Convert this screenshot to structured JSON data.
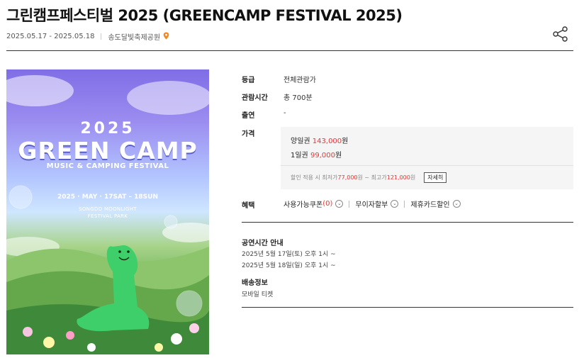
{
  "header": {
    "title": "그린캠프페스티벌 2025 (GREENCAMP FESTIVAL 2025)",
    "period": "2025.05.17 - 2025.05.18",
    "venue": "송도달빛축제공원",
    "share_icon": "share-icon",
    "pin_icon": "location-pin-icon",
    "pin_color": "#f08a24"
  },
  "poster": {
    "year": "2025",
    "main": "GREEN CAMP",
    "sub": "MUSIC & CAMPING FESTIVAL",
    "dates": "2025 · MAY · 17SAT – 18SUN",
    "venue_line1": "SONGDO MOONLIGHT",
    "venue_line2": "FESTIVAL PARK"
  },
  "info": {
    "grade_label": "등급",
    "grade_value": "전체관람가",
    "runtime_label": "관람시간",
    "runtime_value": "총 700분",
    "cast_label": "출연",
    "cast_value": "-",
    "price_label": "가격",
    "prices": [
      {
        "name": "양일권",
        "amount": "143,000",
        "unit": "원"
      },
      {
        "name": "1일권",
        "amount": "99,000",
        "unit": "원"
      }
    ],
    "discount_prefix": "할인 적용 시 최저가 ",
    "discount_min": "77,000",
    "discount_mid": "원 ~ 최고가 ",
    "discount_max": "121,000",
    "discount_suffix": "원",
    "detail_button": "자세히",
    "benefit_label": "혜택",
    "benefit_coupon": "사용가능쿠폰",
    "benefit_coupon_count": "(0)",
    "benefit_installment": "무이자할부",
    "benefit_card": "제휴카드할인"
  },
  "schedule": {
    "title": "공연시간 안내",
    "lines": [
      "2025년 5월 17일(토) 오후 1시 ~",
      "2025년 5월 18일(일) 오후 1시 ~"
    ]
  },
  "delivery": {
    "title": "배송정보",
    "value": "모바일 티켓"
  },
  "colors": {
    "accent_red": "#e03a3a",
    "rule": "#333333"
  }
}
